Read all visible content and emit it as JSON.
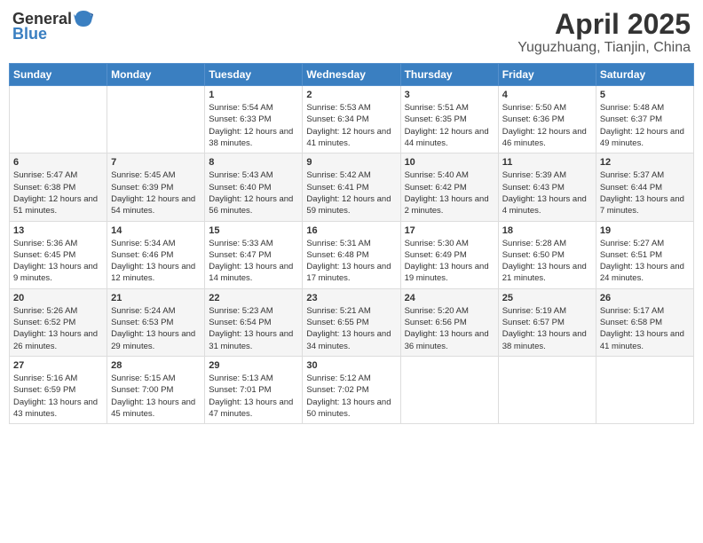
{
  "header": {
    "logo_general": "General",
    "logo_blue": "Blue",
    "month_title": "April 2025",
    "location": "Yuguzhuang, Tianjin, China"
  },
  "weekdays": [
    "Sunday",
    "Monday",
    "Tuesday",
    "Wednesday",
    "Thursday",
    "Friday",
    "Saturday"
  ],
  "weeks": [
    [
      {
        "day": "",
        "info": ""
      },
      {
        "day": "",
        "info": ""
      },
      {
        "day": "1",
        "info": "Sunrise: 5:54 AM\nSunset: 6:33 PM\nDaylight: 12 hours and 38 minutes."
      },
      {
        "day": "2",
        "info": "Sunrise: 5:53 AM\nSunset: 6:34 PM\nDaylight: 12 hours and 41 minutes."
      },
      {
        "day": "3",
        "info": "Sunrise: 5:51 AM\nSunset: 6:35 PM\nDaylight: 12 hours and 44 minutes."
      },
      {
        "day": "4",
        "info": "Sunrise: 5:50 AM\nSunset: 6:36 PM\nDaylight: 12 hours and 46 minutes."
      },
      {
        "day": "5",
        "info": "Sunrise: 5:48 AM\nSunset: 6:37 PM\nDaylight: 12 hours and 49 minutes."
      }
    ],
    [
      {
        "day": "6",
        "info": "Sunrise: 5:47 AM\nSunset: 6:38 PM\nDaylight: 12 hours and 51 minutes."
      },
      {
        "day": "7",
        "info": "Sunrise: 5:45 AM\nSunset: 6:39 PM\nDaylight: 12 hours and 54 minutes."
      },
      {
        "day": "8",
        "info": "Sunrise: 5:43 AM\nSunset: 6:40 PM\nDaylight: 12 hours and 56 minutes."
      },
      {
        "day": "9",
        "info": "Sunrise: 5:42 AM\nSunset: 6:41 PM\nDaylight: 12 hours and 59 minutes."
      },
      {
        "day": "10",
        "info": "Sunrise: 5:40 AM\nSunset: 6:42 PM\nDaylight: 13 hours and 2 minutes."
      },
      {
        "day": "11",
        "info": "Sunrise: 5:39 AM\nSunset: 6:43 PM\nDaylight: 13 hours and 4 minutes."
      },
      {
        "day": "12",
        "info": "Sunrise: 5:37 AM\nSunset: 6:44 PM\nDaylight: 13 hours and 7 minutes."
      }
    ],
    [
      {
        "day": "13",
        "info": "Sunrise: 5:36 AM\nSunset: 6:45 PM\nDaylight: 13 hours and 9 minutes."
      },
      {
        "day": "14",
        "info": "Sunrise: 5:34 AM\nSunset: 6:46 PM\nDaylight: 13 hours and 12 minutes."
      },
      {
        "day": "15",
        "info": "Sunrise: 5:33 AM\nSunset: 6:47 PM\nDaylight: 13 hours and 14 minutes."
      },
      {
        "day": "16",
        "info": "Sunrise: 5:31 AM\nSunset: 6:48 PM\nDaylight: 13 hours and 17 minutes."
      },
      {
        "day": "17",
        "info": "Sunrise: 5:30 AM\nSunset: 6:49 PM\nDaylight: 13 hours and 19 minutes."
      },
      {
        "day": "18",
        "info": "Sunrise: 5:28 AM\nSunset: 6:50 PM\nDaylight: 13 hours and 21 minutes."
      },
      {
        "day": "19",
        "info": "Sunrise: 5:27 AM\nSunset: 6:51 PM\nDaylight: 13 hours and 24 minutes."
      }
    ],
    [
      {
        "day": "20",
        "info": "Sunrise: 5:26 AM\nSunset: 6:52 PM\nDaylight: 13 hours and 26 minutes."
      },
      {
        "day": "21",
        "info": "Sunrise: 5:24 AM\nSunset: 6:53 PM\nDaylight: 13 hours and 29 minutes."
      },
      {
        "day": "22",
        "info": "Sunrise: 5:23 AM\nSunset: 6:54 PM\nDaylight: 13 hours and 31 minutes."
      },
      {
        "day": "23",
        "info": "Sunrise: 5:21 AM\nSunset: 6:55 PM\nDaylight: 13 hours and 34 minutes."
      },
      {
        "day": "24",
        "info": "Sunrise: 5:20 AM\nSunset: 6:56 PM\nDaylight: 13 hours and 36 minutes."
      },
      {
        "day": "25",
        "info": "Sunrise: 5:19 AM\nSunset: 6:57 PM\nDaylight: 13 hours and 38 minutes."
      },
      {
        "day": "26",
        "info": "Sunrise: 5:17 AM\nSunset: 6:58 PM\nDaylight: 13 hours and 41 minutes."
      }
    ],
    [
      {
        "day": "27",
        "info": "Sunrise: 5:16 AM\nSunset: 6:59 PM\nDaylight: 13 hours and 43 minutes."
      },
      {
        "day": "28",
        "info": "Sunrise: 5:15 AM\nSunset: 7:00 PM\nDaylight: 13 hours and 45 minutes."
      },
      {
        "day": "29",
        "info": "Sunrise: 5:13 AM\nSunset: 7:01 PM\nDaylight: 13 hours and 47 minutes."
      },
      {
        "day": "30",
        "info": "Sunrise: 5:12 AM\nSunset: 7:02 PM\nDaylight: 13 hours and 50 minutes."
      },
      {
        "day": "",
        "info": ""
      },
      {
        "day": "",
        "info": ""
      },
      {
        "day": "",
        "info": ""
      }
    ]
  ]
}
